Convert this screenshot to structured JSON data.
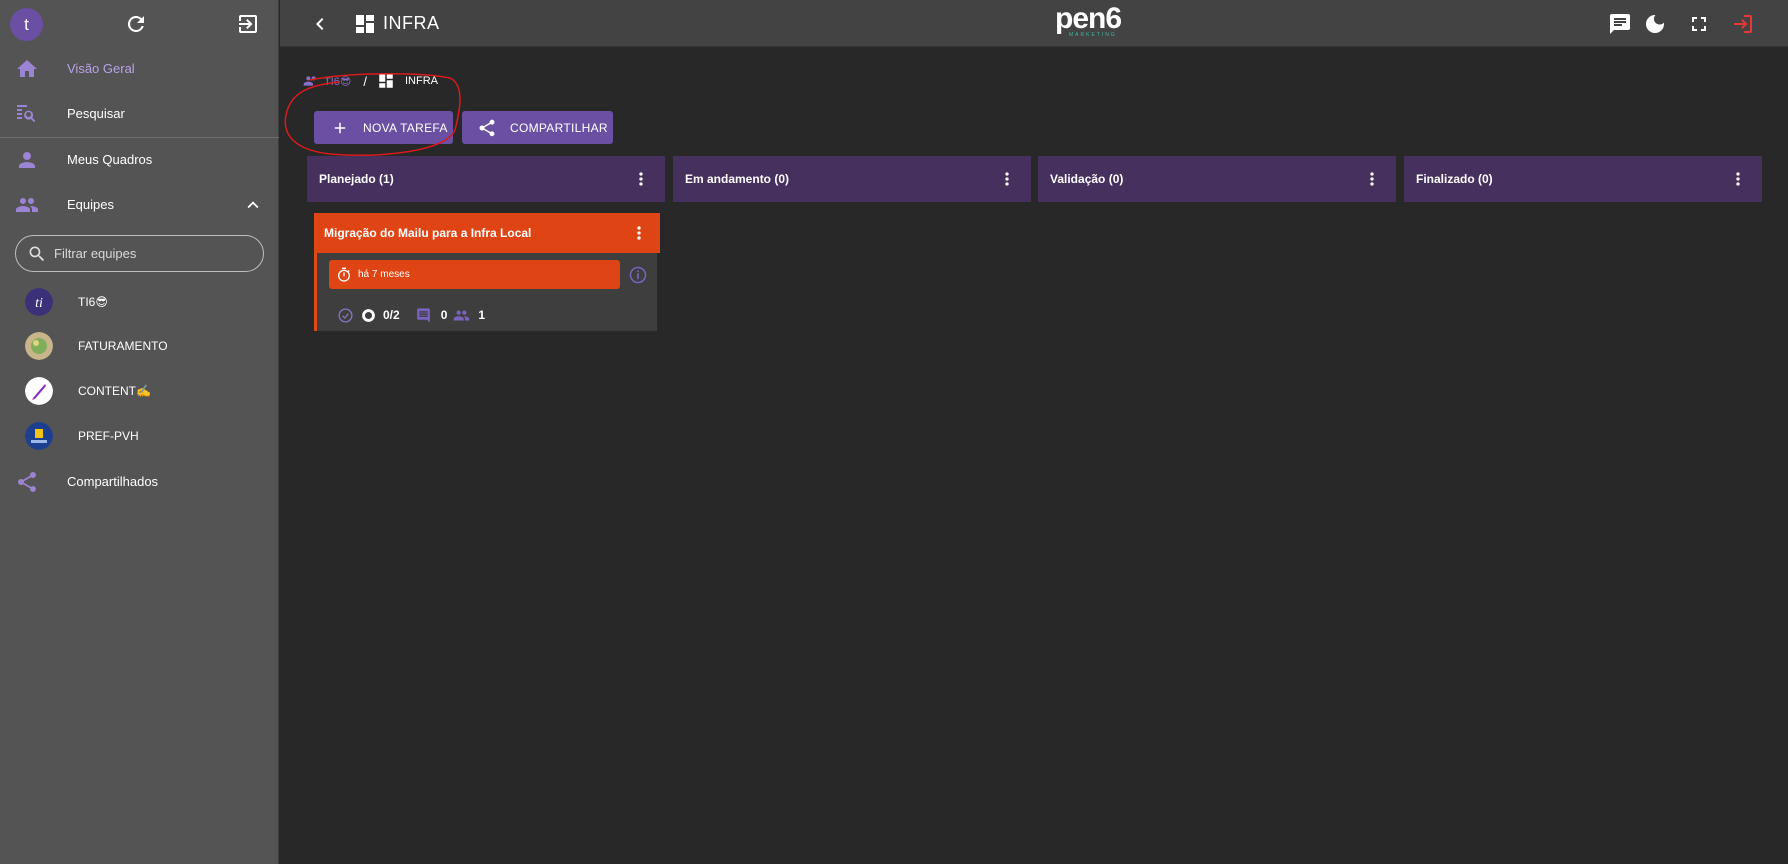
{
  "sidebar": {
    "user_initial": "t",
    "nav": {
      "overview": "Visão Geral",
      "search": "Pesquisar",
      "my_boards": "Meus Quadros",
      "teams": "Equipes",
      "shared": "Compartilhados"
    },
    "filter_placeholder": "Filtrar equipes",
    "teams": [
      {
        "name": "TI6😎"
      },
      {
        "name": "FATURAMENTO"
      },
      {
        "name": "CONTENT✍️"
      },
      {
        "name": "PREF-PVH"
      }
    ]
  },
  "topbar": {
    "title": "INFRA",
    "brand": "pen6",
    "brand_sub": "MARKETING"
  },
  "breadcrumb": {
    "team": "TI6😎",
    "separator": "/",
    "board": "INFRA"
  },
  "actions": {
    "new_task": "NOVA TAREFA",
    "share": "COMPARTILHAR"
  },
  "columns": [
    {
      "label": "Planejado (1)"
    },
    {
      "label": "Em andamento (0)"
    },
    {
      "label": "Validação (0)"
    },
    {
      "label": "Finalizado (0)"
    }
  ],
  "card": {
    "title": "Migração do Mailu para a Infra Local",
    "due": "há 7 meses",
    "checklist": "0/2",
    "comments": "0",
    "members": "1"
  },
  "colors": {
    "accent": "#6a4fa3",
    "column_header": "#45305e",
    "card_orange": "#df4414",
    "logout_red": "#e53935"
  }
}
